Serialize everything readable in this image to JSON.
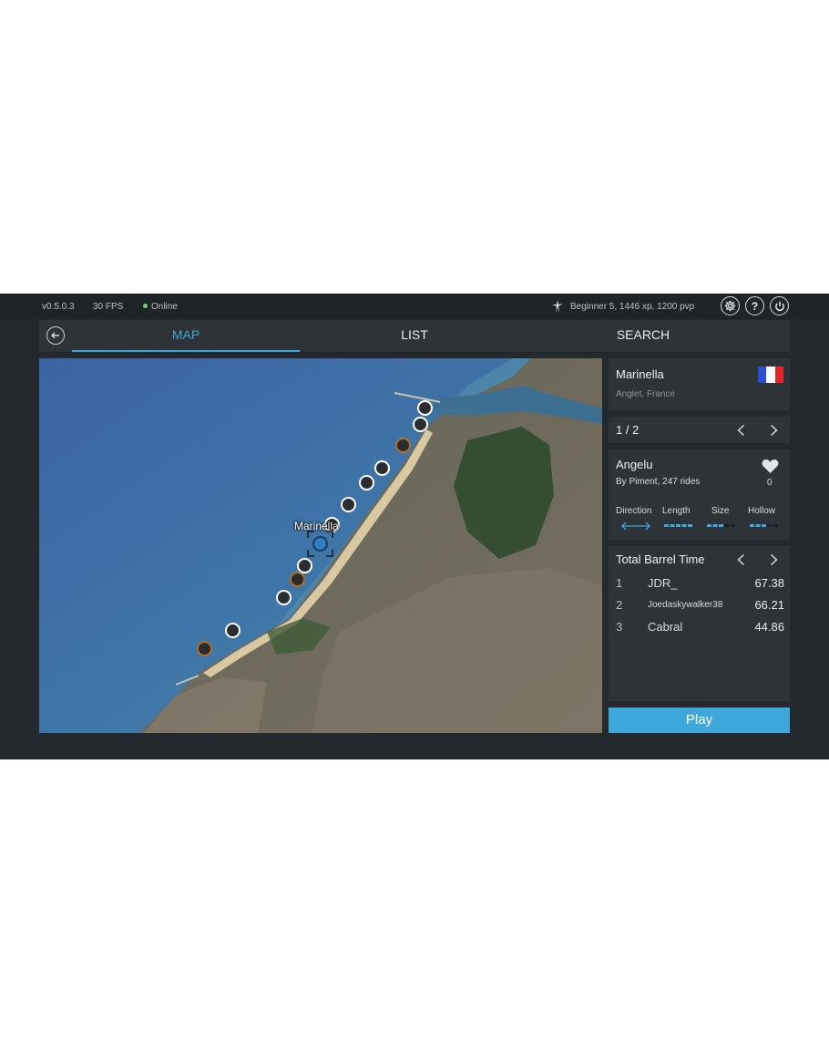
{
  "status": {
    "version": "v0.5.0.3",
    "fps": "30 FPS",
    "connection": "Online",
    "profile": "Beginner 5, 1446 xp, 1200 pvp",
    "icons": [
      "gear-icon",
      "help-icon",
      "power-icon"
    ]
  },
  "nav": {
    "back_icon": "back-arrow-icon",
    "tabs": [
      {
        "label": "MAP",
        "active": true
      },
      {
        "label": "LIST",
        "active": false
      },
      {
        "label": "SEARCH",
        "active": false
      }
    ]
  },
  "map": {
    "selected_label": "Marinella"
  },
  "spot": {
    "name": "Marinella",
    "location": "Anglet, France",
    "flag": "france-flag"
  },
  "pager": {
    "label": "1 / 2"
  },
  "wave": {
    "name": "Angelu",
    "meta": "By Piment, 247 rides",
    "likes": "0",
    "attributes": {
      "direction_label": "Direction",
      "length_label": "Length",
      "size_label": "Size",
      "hollow_label": "Hollow",
      "length_level": 1.0,
      "size_level": 0.6,
      "hollow_level": 0.6
    }
  },
  "leaderboard": {
    "title": "Total Barrel Time",
    "rows": [
      {
        "rank": "1",
        "player": "JDR_",
        "score": "67.38"
      },
      {
        "rank": "2",
        "player": "Joedaskywalker38",
        "score": "66.21"
      },
      {
        "rank": "3",
        "player": "Cabral",
        "score": "44.86"
      }
    ]
  },
  "play_label": "Play",
  "colors": {
    "accent": "#3ea8dc",
    "background": "#24292d",
    "panel": "#2d3337",
    "online": "#6fcf7a"
  }
}
